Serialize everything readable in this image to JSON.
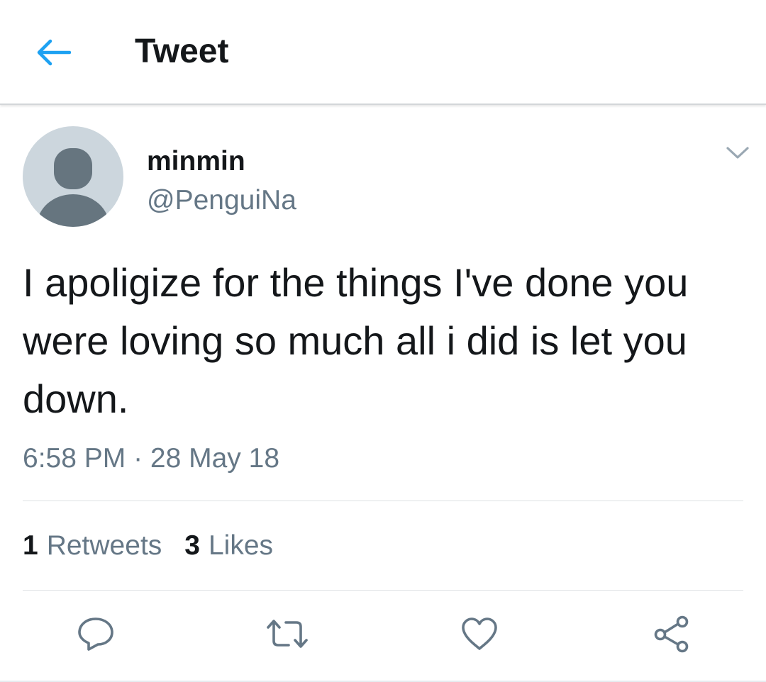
{
  "header": {
    "title": "Tweet",
    "back_icon": "arrow-left-icon"
  },
  "tweet": {
    "author": {
      "display_name": "minmin",
      "handle": "@PenguiNa",
      "avatar_icon": "default-avatar-icon"
    },
    "menu_icon": "chevron-down-icon",
    "text": "I apoligize for the things I've done you were loving so much all i did is let you down.",
    "timestamp": "6:58 PM · 28 May 18",
    "stats": {
      "retweets_count": "1",
      "retweets_label": "Retweets",
      "likes_count": "3",
      "likes_label": "Likes"
    },
    "actions": [
      {
        "name": "reply",
        "icon": "reply-bubble-icon"
      },
      {
        "name": "retweet",
        "icon": "retweet-icon"
      },
      {
        "name": "like",
        "icon": "heart-icon"
      },
      {
        "name": "share",
        "icon": "share-icon"
      }
    ]
  },
  "colors": {
    "accent": "#1da1f2",
    "text_primary": "#14171a",
    "text_secondary": "#657786",
    "avatar_bg": "#ccd6dd",
    "avatar_fg": "#66757f",
    "divider": "#dde1e4"
  }
}
